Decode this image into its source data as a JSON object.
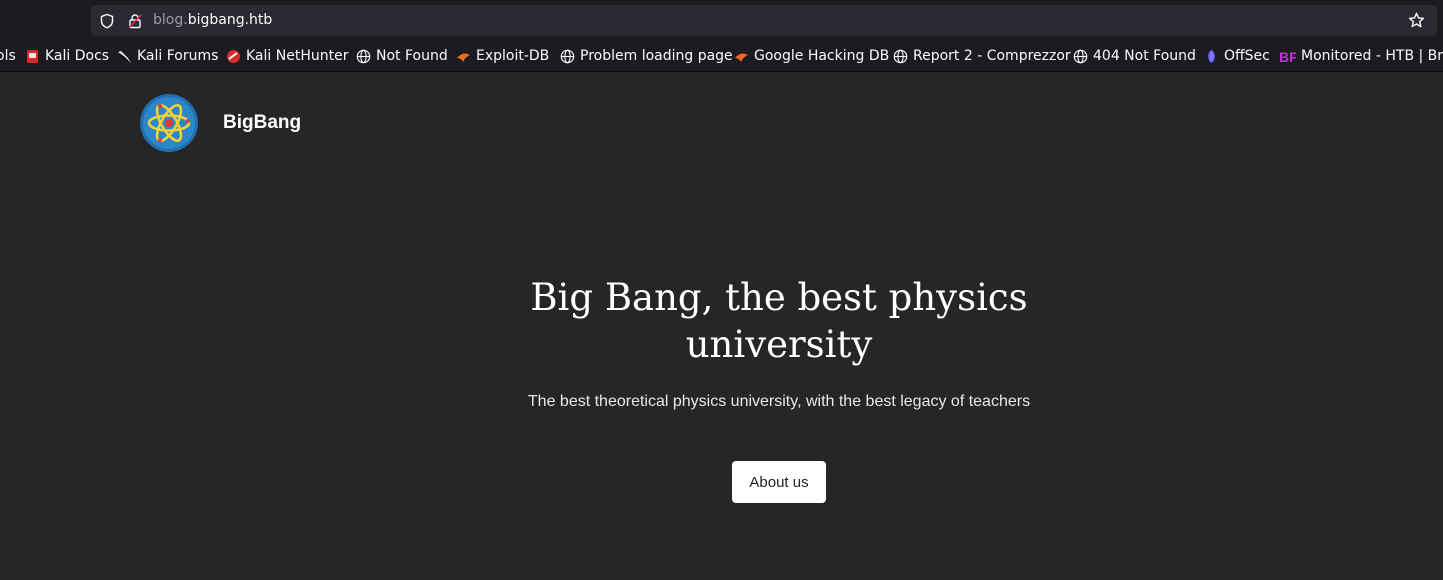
{
  "browser": {
    "url_prefix": "blog.",
    "url_domain": "bigbang.htb",
    "bookmarks": [
      {
        "label": "ols",
        "icon": "partial-bookmark"
      },
      {
        "label": "Kali Docs",
        "icon": "kali-docs-icon"
      },
      {
        "label": "Kali Forums",
        "icon": "kali-dragon-icon"
      },
      {
        "label": "Kali NetHunter",
        "icon": "nethunter-icon"
      },
      {
        "label": "Not Found",
        "icon": "globe-icon"
      },
      {
        "label": "Exploit-DB",
        "icon": "exploitdb-icon"
      },
      {
        "label": "Problem loading page",
        "icon": "globe-icon"
      },
      {
        "label": "Google Hacking DB",
        "icon": "exploitdb-icon"
      },
      {
        "label": "Report 2 - Comprezzor",
        "icon": "globe-icon"
      },
      {
        "label": "404 Not Found",
        "icon": "globe-icon"
      },
      {
        "label": "OffSec",
        "icon": "offsec-icon"
      },
      {
        "label": "Monitored - HTB | Bre...",
        "icon": "bf-icon"
      }
    ]
  },
  "site": {
    "name": "BigBang",
    "logo_icon": "atom-logo-icon"
  },
  "hero": {
    "title": "Big Bang, the best physics university",
    "subtitle": "The best theoretical physics university, with the best legacy of teachers",
    "button_label": "About us"
  },
  "colors": {
    "page_bg": "#262626",
    "toolbar_bg": "#1c1b22",
    "urlbar_bg": "#2b2a33"
  }
}
